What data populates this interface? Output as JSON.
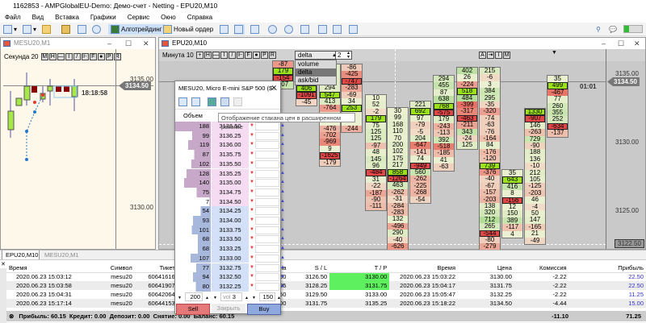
{
  "window": {
    "title": "1162853 - AMPGlobalEU-Demo: Демо-счет - Netting - EPU20,M10"
  },
  "menu": [
    "Файл",
    "Вид",
    "Вставка",
    "Графики",
    "Сервис",
    "Окно",
    "Справка"
  ],
  "toolbar": {
    "algo_label": "Алготрейдинг",
    "new_order_label": "Новый ордер"
  },
  "left_chart": {
    "title": "MESU20,M1",
    "timeframe": "Секунда",
    "period": "20",
    "buttons": [
      "M",
      "H",
      "—",
      "I",
      "/",
      "⊩",
      "F",
      "●",
      "P",
      "R"
    ],
    "axis": [
      "3135.00",
      "3130.00"
    ],
    "last_price": "3134.50",
    "timer": "18:18:58"
  },
  "main_chart": {
    "title": "EPU20,M10",
    "timeframe": "Минута",
    "period": "10",
    "buttons": [
      "+",
      "H",
      "—",
      "I",
      "/",
      "⊩",
      "F",
      "●",
      "P",
      "R"
    ],
    "mode_select": {
      "value": "delta",
      "options": [
        "volume",
        "delta",
        "ask/bid"
      ],
      "selected": "delta"
    },
    "step_value": "2",
    "right_buttons": [
      "A",
      "⇥",
      "I",
      "M"
    ],
    "axis": [
      "3135.00",
      "3130.00",
      "3125.00"
    ],
    "last_price": "3134.50",
    "bottom_price": "3122.50",
    "timer": "01:01",
    "clusters": [
      [
        "-87",
        "179",
        "-154",
        "107"
      ],
      [
        "406",
        "-1091",
        "-45"
      ],
      [
        "307",
        "237",
        "302",
        "294",
        "547",
        "413",
        "-764",
        "",
        "",
        "-476",
        "-702",
        "-969",
        "9",
        "-1625",
        "-179"
      ],
      [
        "-86",
        "-425",
        "-747",
        "-283",
        "-69",
        "34",
        "253",
        "",
        "",
        "-244"
      ],
      [
        "10",
        "52",
        "-2",
        "179",
        "75",
        "125",
        "125",
        "-97",
        "48",
        "145",
        "96",
        "-484",
        "31",
        "-22",
        "-187",
        "-90",
        "-111"
      ],
      [
        "30",
        "99",
        "168",
        "110",
        "70",
        "200",
        "102",
        "175",
        "217",
        "858",
        "-1264",
        "463",
        "-262",
        "-31",
        "-284",
        "-283",
        "132",
        "-496",
        "290",
        "-40",
        "-626"
      ],
      [
        "221",
        "692",
        "97",
        "-79",
        "-5",
        "204",
        "-647",
        "-141",
        "74",
        "-949",
        "560",
        "-262",
        "-225",
        "-268",
        "-54"
      ],
      [
        "294",
        "455",
        "87",
        "638",
        "768",
        "-575",
        "179",
        "-243",
        "-113",
        "392",
        "-518",
        "-185",
        "41",
        "-63"
      ],
      [
        "402",
        "26",
        "-224",
        "518",
        "484",
        "-399",
        "-317",
        "-463",
        "-211",
        "343",
        "-24",
        "125"
      ],
      [
        "215",
        "-6",
        "3",
        "384",
        "295",
        "-35",
        "-320",
        "-74",
        "-63",
        "-76",
        "-164",
        "84",
        "-176",
        "-120",
        "739",
        "-376",
        "-40",
        "-67",
        "-157",
        "-203",
        "138",
        "320",
        "712",
        "265",
        "-544",
        "-80",
        "-279",
        "-171"
      ],
      [
        "35",
        "643",
        "416",
        "8",
        "-156",
        "12",
        "150",
        "389",
        "-117",
        "4"
      ],
      [
        "1330",
        "-907",
        "146",
        "-263",
        "729",
        "-90",
        "188",
        "136",
        "-10",
        "212",
        "105",
        "-125",
        "-203",
        "46",
        "-4",
        "50",
        "147",
        "-165",
        "21",
        "-49"
      ],
      [
        "35",
        "499",
        "-467",
        "77",
        "260",
        "355",
        "252",
        "-634",
        "-137"
      ]
    ]
  },
  "tooltip": "Отображение стакана цен в расширенном режиме",
  "order_book": {
    "title": "MESU20, Micro E-mini S&P 500 ($...",
    "volume_header": "Объем",
    "asks": [
      {
        "vol": "188",
        "price": "3136.50"
      },
      {
        "vol": "99",
        "price": "3136.25"
      },
      {
        "vol": "119",
        "price": "3136.00"
      },
      {
        "vol": "87",
        "price": "3135.75"
      },
      {
        "vol": "102",
        "price": "3135.50"
      },
      {
        "vol": "128",
        "price": "3135.25"
      },
      {
        "vol": "140",
        "price": "3135.00"
      },
      {
        "vol": "75",
        "price": "3134.75"
      },
      {
        "vol": "7",
        "price": "3134.50"
      }
    ],
    "bids": [
      {
        "vol": "54",
        "price": "3134.25"
      },
      {
        "vol": "93",
        "price": "3134.00"
      },
      {
        "vol": "101",
        "price": "3133.75"
      },
      {
        "vol": "68",
        "price": "3133.50"
      },
      {
        "vol": "68",
        "price": "3133.25"
      },
      {
        "vol": "107",
        "price": "3133.00"
      },
      {
        "vol": "77",
        "price": "3132.75"
      },
      {
        "vol": "94",
        "price": "3132.50"
      },
      {
        "vol": "80",
        "price": "3132.25"
      }
    ],
    "sell_qty": "200",
    "vol_label": "vol",
    "vol_value": "3",
    "buy_qty": "150",
    "sell_label": "Sell",
    "close_label": "Закрыть",
    "buy_label": "Buy"
  },
  "tabs": [
    "EPU20,M10",
    "MESU20,M1"
  ],
  "positions": {
    "headers": [
      "Время",
      "Символ",
      "Тикет",
      "Цена",
      "S / L",
      "T / P",
      "Время",
      "Цена",
      "Комиссия",
      "Прибыль"
    ],
    "rows": [
      [
        "2020.06.23 15:03:12",
        "mesu20",
        "60641616",
        "3128.50",
        "3126.50",
        "3130.00",
        "2020.06.23 15:03:22",
        "3130.00",
        "-2.22",
        "22.50"
      ],
      [
        "2020.06.23 15:03:58",
        "mesu20",
        "60641907",
        "3130.25",
        "3128.25",
        "3131.75",
        "2020.06.23 15:04:17",
        "3131.75",
        "-2.22",
        "22.50"
      ],
      [
        "2020.06.23 15:04:31",
        "mesu20",
        "60642064",
        "3131.50",
        "3129.50",
        "3133.00",
        "2020.06.23 15:05:47",
        "3132.25",
        "-2.22",
        "11.25"
      ],
      [
        "2020.06.23 15:17:14",
        "mesu20",
        "60644153",
        "3134.00",
        "3131.75",
        "3135.25",
        "2020.06.23 15:18:22",
        "3134.50",
        "-4.44",
        "15.00"
      ]
    ],
    "summary": "Прибыль: 60.15  Кредит: 0.00  Депозит: 0.00  Снятие: 0.00  Баланс: 60.15",
    "total_commission": "-11.10",
    "total_profit": "71.25"
  },
  "colors": {
    "tp_hit": "#5ef05e",
    "profit": "#3030d0",
    "ask_bg": "#f6dcf2",
    "bid_bg": "#d3e0f7",
    "sell": "#e57878",
    "buy": "#8fa9df",
    "chart_bg": "#c9c9c9",
    "left_chart_bg": "#fdf8ea"
  }
}
